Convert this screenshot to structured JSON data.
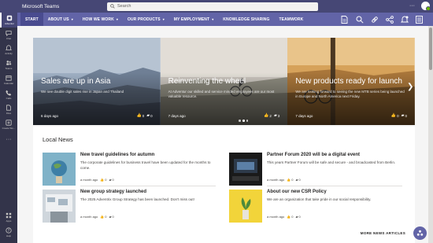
{
  "app": {
    "title": "Microsoft Teams",
    "search_placeholder": "Search",
    "more": "···"
  },
  "rail": {
    "items": [
      {
        "label": "Adventur"
      },
      {
        "label": "Chat"
      },
      {
        "label": "Activity"
      },
      {
        "label": "Teams"
      },
      {
        "label": "Calendar"
      },
      {
        "label": "Calls"
      },
      {
        "label": "Files"
      },
      {
        "label": "Create Wo..."
      },
      {
        "label": "···"
      }
    ],
    "bottom": [
      {
        "label": "Apps"
      },
      {
        "label": "Help"
      }
    ]
  },
  "nav": {
    "items": [
      {
        "label": "START",
        "caret": ""
      },
      {
        "label": "ABOUT US",
        "caret": "▾"
      },
      {
        "label": "HOW WE WORK",
        "caret": "▾"
      },
      {
        "label": "OUR PRODUCTS",
        "caret": "▾"
      },
      {
        "label": "MY EMPLOYMENT",
        "caret": "▾"
      },
      {
        "label": "KNOWLEDGE SHARING",
        "caret": ""
      },
      {
        "label": "TEAMWORK",
        "caret": ""
      }
    ]
  },
  "carousel": {
    "slides": [
      {
        "title": "Sales are up in Asia",
        "desc": "We see double digit sales rise in Japan and Thailand",
        "date": "6 days ago",
        "likes": "0",
        "comments": "0"
      },
      {
        "title": "Reinventing the wheel",
        "desc": "At Adventur our skilled and service minded employees are our most valuable resource.",
        "date": "7 days ago",
        "likes": "2",
        "comments": "3"
      },
      {
        "title": "New products ready for launch",
        "desc": "We are looking forward to seeing the new MTB series being launched in Europe and North America next Friday.",
        "date": "7 days ago",
        "likes": "0",
        "comments": "0"
      }
    ],
    "next_arrow": "❯"
  },
  "news": {
    "heading": "Local News",
    "items": [
      {
        "title": "New travel guidelines for autumn",
        "desc": "The corporate guidelines for business travel have been updated for the months to come.",
        "date": "a month ago",
        "likes": "0",
        "comments": "0"
      },
      {
        "title": "Partner Forum 2020 will be a digital event",
        "desc": "This years Partner Forum will be safe and secure - and broadcasted from Berlin.",
        "date": "a month ago",
        "likes": "0",
        "comments": "0"
      },
      {
        "title": "New group strategy launched",
        "desc": "The 2025 Adventrix Group Strategy has been launched. Don't miss out!",
        "date": "a month ago",
        "likes": "0",
        "comments": "0"
      },
      {
        "title": "About our new CSR Policy",
        "desc": "We are an organization that take pride in our social responsibility.",
        "date": "a month ago",
        "likes": "0",
        "comments": "0"
      }
    ],
    "more_label": "MORE NEWS ARTICLES"
  },
  "colors": {
    "topbar": "#464775",
    "nav": "#6264a7",
    "rail": "#33344a",
    "status": "#6bb700"
  }
}
